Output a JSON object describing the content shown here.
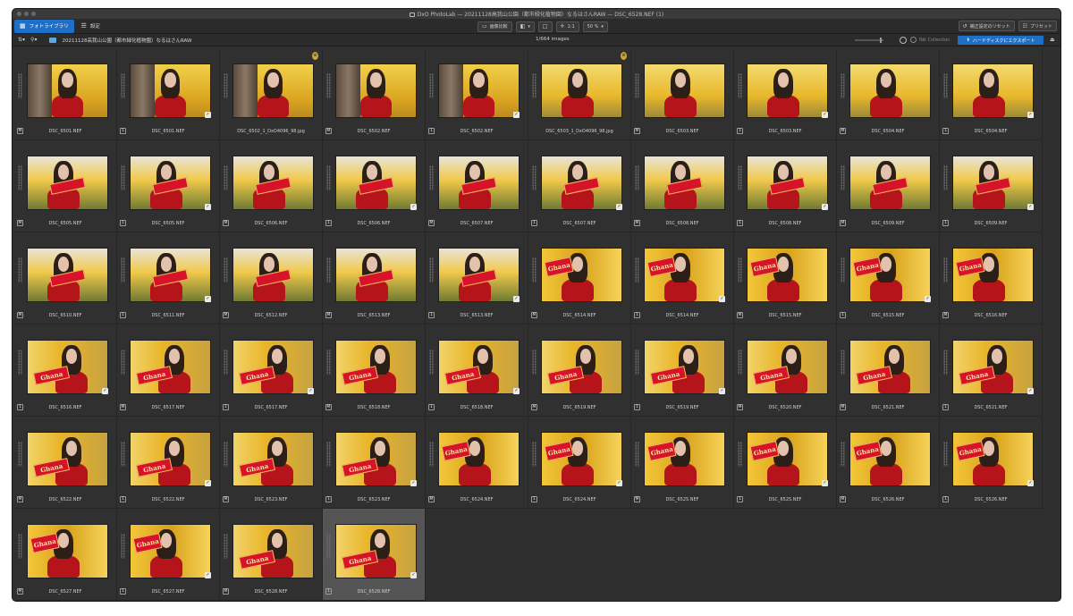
{
  "window": {
    "title": "DxO PhotoLab — 20211128高我山公園（都市緑化植物園）なるはさんRAW — DSC_6528.NEF (1)"
  },
  "toolbar": {
    "tab_library": "フォトライブラリ",
    "tab_settings": "設定",
    "compare_label": "画像比較",
    "zoom_ratio": "1:1",
    "zoom_value": "50 %",
    "reset_label": "補正設定のリセット",
    "preset_label": "プリセット"
  },
  "browser": {
    "folder_path": "20211128高我山公園（都市緑化植物園）なるはさんRAW",
    "image_count": "1/664 images",
    "filter_label": "Nik Collection",
    "export_label": "ハードディスクにエクスポート"
  },
  "thumbnails": [
    {
      "name": "DSC_6501.NEF",
      "badge": "M",
      "checked": false,
      "scene": "tree"
    },
    {
      "name": "DSC_6501.NEF",
      "badge": "1",
      "checked": true,
      "scene": "tree"
    },
    {
      "name": "DSC_6502_1_DxO4096_98.jpg",
      "badge": "",
      "checked": false,
      "scene": "tree",
      "vc": true
    },
    {
      "name": "DSC_6502.NEF",
      "badge": "M",
      "checked": false,
      "scene": "tree"
    },
    {
      "name": "DSC_6502.NEF",
      "badge": "1",
      "checked": true,
      "scene": "tree"
    },
    {
      "name": "DSC_6503_1_DxO4096_98.jpg",
      "badge": "",
      "checked": false,
      "scene": "yellow",
      "vc": true
    },
    {
      "name": "DSC_6503.NEF",
      "badge": "M",
      "checked": false,
      "scene": "yellow"
    },
    {
      "name": "DSC_6503.NEF",
      "badge": "1",
      "checked": true,
      "scene": "yellow"
    },
    {
      "name": "DSC_6504.NEF",
      "badge": "M",
      "checked": false,
      "scene": "yellow"
    },
    {
      "name": "DSC_6504.NEF",
      "badge": "1",
      "checked": true,
      "scene": "yellow"
    },
    {
      "name": "DSC_6505.NEF",
      "badge": "M",
      "checked": false,
      "scene": "sky"
    },
    {
      "name": "DSC_6505.NEF",
      "badge": "1",
      "checked": true,
      "scene": "sky"
    },
    {
      "name": "DSC_6506.NEF",
      "badge": "M",
      "checked": false,
      "scene": "sky"
    },
    {
      "name": "DSC_6506.NEF",
      "badge": "1",
      "checked": true,
      "scene": "sky"
    },
    {
      "name": "DSC_6507.NEF",
      "badge": "M",
      "checked": false,
      "scene": "sky"
    },
    {
      "name": "DSC_6507.NEF",
      "badge": "1",
      "checked": true,
      "scene": "sky"
    },
    {
      "name": "DSC_6508.NEF",
      "badge": "M",
      "checked": false,
      "scene": "sky"
    },
    {
      "name": "DSC_6508.NEF",
      "badge": "1",
      "checked": true,
      "scene": "sky"
    },
    {
      "name": "DSC_6509.NEF",
      "badge": "M",
      "checked": false,
      "scene": "sky"
    },
    {
      "name": "DSC_6509.NEF",
      "badge": "1",
      "checked": true,
      "scene": "sky"
    },
    {
      "name": "DSC_6510.NEF",
      "badge": "M",
      "checked": false,
      "scene": "sky"
    },
    {
      "name": "DSC_6511.NEF",
      "badge": "1",
      "checked": true,
      "scene": "sky"
    },
    {
      "name": "DSC_6512.NEF",
      "badge": "M",
      "checked": false,
      "scene": "sky"
    },
    {
      "name": "DSC_6513.NEF",
      "badge": "M",
      "checked": false,
      "scene": "sky"
    },
    {
      "name": "DSC_6513.NEF",
      "badge": "1",
      "checked": true,
      "scene": "sky"
    },
    {
      "name": "DSC_6514.NEF",
      "badge": "M",
      "checked": false,
      "scene": "ghana"
    },
    {
      "name": "DSC_6514.NEF",
      "badge": "1",
      "checked": true,
      "scene": "ghana"
    },
    {
      "name": "DSC_6515.NEF",
      "badge": "M",
      "checked": false,
      "scene": "ghana"
    },
    {
      "name": "DSC_6515.NEF",
      "badge": "1",
      "checked": true,
      "scene": "ghana"
    },
    {
      "name": "DSC_6516.NEF",
      "badge": "M",
      "checked": false,
      "scene": "ghana"
    },
    {
      "name": "DSC_6516.NEF",
      "badge": "1",
      "checked": true,
      "scene": "ghana2"
    },
    {
      "name": "DSC_6517.NEF",
      "badge": "M",
      "checked": false,
      "scene": "ghana2"
    },
    {
      "name": "DSC_6517.NEF",
      "badge": "1",
      "checked": true,
      "scene": "ghana2"
    },
    {
      "name": "DSC_6518.NEF",
      "badge": "M",
      "checked": false,
      "scene": "ghana2"
    },
    {
      "name": "DSC_6518.NEF",
      "badge": "1",
      "checked": true,
      "scene": "ghana2"
    },
    {
      "name": "DSC_6519.NEF",
      "badge": "M",
      "checked": false,
      "scene": "ghana2"
    },
    {
      "name": "DSC_6519.NEF",
      "badge": "1",
      "checked": true,
      "scene": "ghana2"
    },
    {
      "name": "DSC_6520.NEF",
      "badge": "M",
      "checked": false,
      "scene": "ghana2"
    },
    {
      "name": "DSC_6521.NEF",
      "badge": "M",
      "checked": false,
      "scene": "ghana2"
    },
    {
      "name": "DSC_6521.NEF",
      "badge": "1",
      "checked": true,
      "scene": "ghana2"
    },
    {
      "name": "DSC_6522.NEF",
      "badge": "M",
      "checked": false,
      "scene": "ghana2"
    },
    {
      "name": "DSC_6522.NEF",
      "badge": "1",
      "checked": true,
      "scene": "ghana2"
    },
    {
      "name": "DSC_6523.NEF",
      "badge": "M",
      "checked": false,
      "scene": "ghana2"
    },
    {
      "name": "DSC_6523.NEF",
      "badge": "1",
      "checked": true,
      "scene": "ghana2"
    },
    {
      "name": "DSC_6524.NEF",
      "badge": "M",
      "checked": false,
      "scene": "ghana"
    },
    {
      "name": "DSC_6524.NEF",
      "badge": "1",
      "checked": true,
      "scene": "ghana"
    },
    {
      "name": "DSC_6525.NEF",
      "badge": "M",
      "checked": false,
      "scene": "ghana"
    },
    {
      "name": "DSC_6525.NEF",
      "badge": "1",
      "checked": true,
      "scene": "ghana"
    },
    {
      "name": "DSC_6526.NEF",
      "badge": "M",
      "checked": false,
      "scene": "ghana"
    },
    {
      "name": "DSC_6526.NEF",
      "badge": "1",
      "checked": true,
      "scene": "ghana"
    },
    {
      "name": "DSC_6527.NEF",
      "badge": "M",
      "checked": false,
      "scene": "ghana"
    },
    {
      "name": "DSC_6527.NEF",
      "badge": "1",
      "checked": true,
      "scene": "ghana"
    },
    {
      "name": "DSC_6528.NEF",
      "badge": "M",
      "checked": false,
      "scene": "ghana2"
    },
    {
      "name": "DSC_6528.NEF",
      "badge": "1",
      "checked": true,
      "scene": "ghana2",
      "selected": true
    }
  ],
  "colors": {
    "accent": "#1e6fc8",
    "background": "#2f2f2f",
    "selected_cell": "#555555",
    "ghana_red": "#d7132a",
    "ginkgo_yellow": "#e8b82a"
  },
  "icons": {
    "library": "photo-library-icon",
    "settings": "sliders-icon",
    "compare": "compare-icon",
    "export": "export-icon",
    "lock": "lock-icon"
  }
}
